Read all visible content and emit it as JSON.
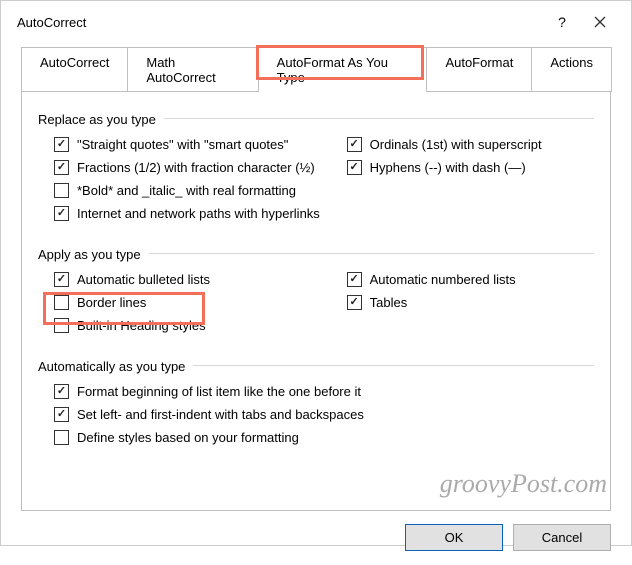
{
  "window": {
    "title": "AutoCorrect",
    "help": "?",
    "close": "×"
  },
  "tabs": [
    {
      "label": "AutoCorrect",
      "active": false
    },
    {
      "label": "Math AutoCorrect",
      "active": false
    },
    {
      "label": "AutoFormat As You Type",
      "active": true
    },
    {
      "label": "AutoFormat",
      "active": false
    },
    {
      "label": "Actions",
      "active": false
    }
  ],
  "sections": {
    "replace": {
      "label": "Replace as you type",
      "left": [
        {
          "label": "\"Straight quotes\" with \"smart quotes\"",
          "checked": true
        },
        {
          "label": "Fractions (1/2) with fraction character (½)",
          "checked": true
        },
        {
          "label": "*Bold* and _italic_ with real formatting",
          "checked": false
        },
        {
          "label": "Internet and network paths with hyperlinks",
          "checked": true
        }
      ],
      "right": [
        {
          "label": "Ordinals (1st) with superscript",
          "checked": true
        },
        {
          "label": "Hyphens (--) with dash (—)",
          "checked": true
        }
      ]
    },
    "apply": {
      "label": "Apply as you type",
      "left": [
        {
          "label": "Automatic bulleted lists",
          "checked": true
        },
        {
          "label": "Border lines",
          "checked": false
        },
        {
          "label": "Built-in Heading styles",
          "checked": false
        }
      ],
      "right": [
        {
          "label": "Automatic numbered lists",
          "checked": true
        },
        {
          "label": "Tables",
          "checked": true
        }
      ]
    },
    "auto": {
      "label": "Automatically as you type",
      "items": [
        {
          "label": "Format beginning of list item like the one before it",
          "checked": true
        },
        {
          "label": "Set left- and first-indent with tabs and backspaces",
          "checked": true
        },
        {
          "label": "Define styles based on your formatting",
          "checked": false
        }
      ]
    }
  },
  "buttons": {
    "ok": "OK",
    "cancel": "Cancel"
  },
  "watermark": "groovyPost.com"
}
